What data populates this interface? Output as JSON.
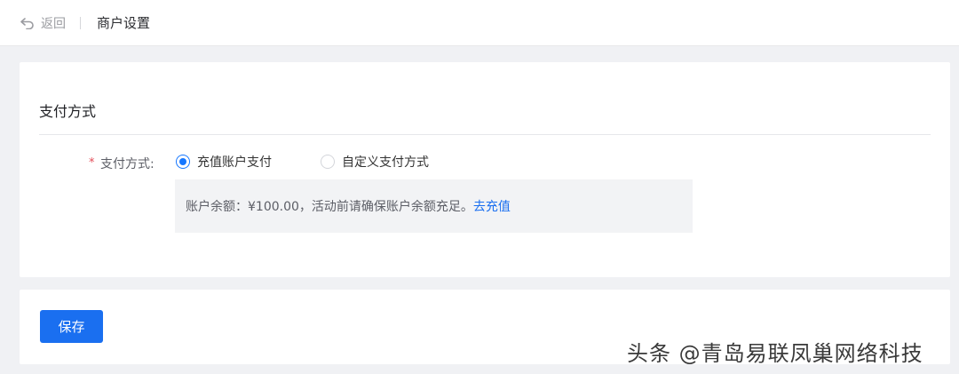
{
  "header": {
    "back_label": "返回",
    "title": "商户设置"
  },
  "section": {
    "title": "支付方式"
  },
  "form": {
    "required_mark": "*",
    "label": "支付方式:",
    "options": [
      {
        "label": "充值账户支付",
        "checked": true
      },
      {
        "label": "自定义支付方式",
        "checked": false
      }
    ],
    "balance_text": "账户余额：¥100.00，活动前请确保账户余额充足。",
    "topup_link": "去充值"
  },
  "footer": {
    "save_label": "保存"
  },
  "watermark": {
    "text": "头条 @青岛易联凤巢网络科技"
  },
  "colors": {
    "accent": "#1a6ff0",
    "required": "#e34d59",
    "background": "#f0f1f4"
  }
}
